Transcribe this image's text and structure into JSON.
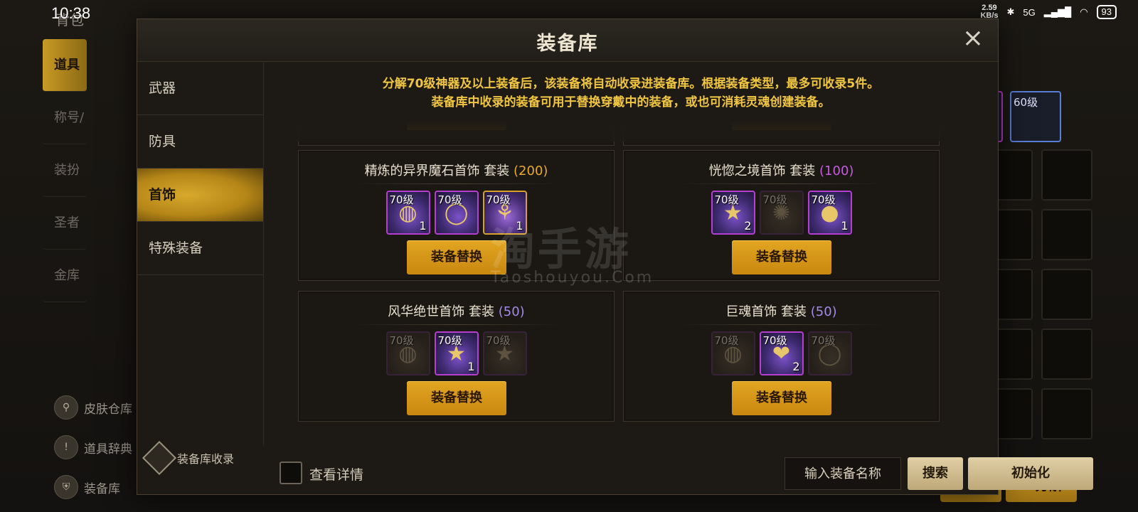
{
  "status_bar": {
    "time": "10:38",
    "speed_top": "2.59",
    "speed_bottom": "KB/s",
    "network": "5G",
    "battery": "93"
  },
  "background": {
    "title": "背包",
    "nav": [
      "道具",
      "称号/勋章",
      "装扮",
      "圣者封印",
      "金库"
    ],
    "active_nav": 0,
    "tools": [
      "皮肤仓库",
      "道具辞典",
      "装备库"
    ],
    "slot_label": "60级",
    "sell_label": "售",
    "decompose_label": "分解"
  },
  "modal": {
    "title": "装备库",
    "close": "×",
    "categories": [
      "武器",
      "防具",
      "首饰",
      "特殊装备"
    ],
    "active_category": 2,
    "notice_line1": "分解70级神器及以上装备后，该装备将自动收录进装备库。根据装备类型，最多可收录5件。",
    "notice_line2": "装备库中收录的装备可用于替换穿戴中的装备，或也可消耗灵魂创建装备。",
    "collect_link": "装备库收录",
    "sets": [
      {
        "name": "精炼的异界魔石首饰",
        "suit": "套装",
        "points": "(200)",
        "points_color": "gold",
        "items": [
          {
            "level": "70级",
            "count": "1",
            "rarity": "epic",
            "icon": "bracelet-icon"
          },
          {
            "level": "70级",
            "count": "",
            "rarity": "epic",
            "icon": "ring-icon"
          },
          {
            "level": "70级",
            "count": "1",
            "rarity": "legend",
            "icon": "necklace-icon"
          }
        ],
        "button": "装备替换"
      },
      {
        "name": "恍惚之境首饰",
        "suit": "套装",
        "points": "(100)",
        "points_color": "purple",
        "items": [
          {
            "level": "70级",
            "count": "2",
            "rarity": "epic",
            "icon": "star-icon"
          },
          {
            "level": "70级",
            "count": "",
            "rarity": "dim",
            "icon": "gem-icon"
          },
          {
            "level": "70级",
            "count": "1",
            "rarity": "epic",
            "icon": "orb-icon"
          }
        ],
        "button": "装备替换"
      },
      {
        "name": "风华绝世首饰",
        "suit": "套装",
        "points": "(50)",
        "points_color": "violet",
        "items": [
          {
            "level": "70级",
            "count": "",
            "rarity": "dim",
            "icon": "bracelet-icon"
          },
          {
            "level": "70级",
            "count": "1",
            "rarity": "epic",
            "icon": "star-icon"
          },
          {
            "level": "70级",
            "count": "",
            "rarity": "dim",
            "icon": "star-icon"
          }
        ],
        "button": "装备替换"
      },
      {
        "name": "巨魂首饰",
        "suit": "套装",
        "points": "(50)",
        "points_color": "violet",
        "items": [
          {
            "level": "70级",
            "count": "",
            "rarity": "dim",
            "icon": "bracelet-icon"
          },
          {
            "level": "70级",
            "count": "2",
            "rarity": "epic",
            "icon": "heart-icon"
          },
          {
            "level": "70级",
            "count": "",
            "rarity": "dim",
            "icon": "ring-icon"
          }
        ],
        "button": "装备替换"
      }
    ],
    "footer": {
      "checkbox_label": "查看详情",
      "search_placeholder": "输入装备名称",
      "search_button": "搜索",
      "init_button": "初始化"
    }
  },
  "watermark": {
    "main": "淘手游",
    "sub": "Taoshouyou.Com"
  },
  "colors": {
    "gold": "#e9a92b",
    "purple": "#c65ae0",
    "violet": "#a28be8",
    "accent": "#c98810"
  }
}
